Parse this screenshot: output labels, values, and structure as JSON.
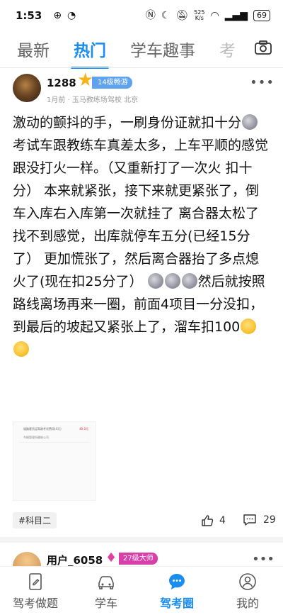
{
  "status_bar": {
    "time": "1:53",
    "network_speed_value": "525",
    "network_speed_unit": "K/s",
    "battery": "69"
  },
  "tabs": [
    {
      "label": "最新"
    },
    {
      "label": "热门"
    },
    {
      "label": "学车趣事"
    },
    {
      "label": "考"
    }
  ],
  "post": {
    "username": "1288",
    "level_badge": "14级畅游",
    "meta": "1月前 · 玉马教练场驾校  北京",
    "text_parts": [
      "激动的颤抖的手，一刷身份证就扣十分",
      " 考试车跟教练车真差太多，上车平顺的感觉跟没打火一样。（又重新打了一次火 扣十分） 本来就紧张，接下来就更紧张了，倒车入库右入库第一次就挂了 离合器太松了 找不到感觉，出库就停车五分(已经15分了） 更加慌张了，然后离合器抬了多点熄火了(现在扣25分了）",
      "然后就按照路线离场再来一圈，前面4项目一分没扣，到最后的坡起又紧张上了，溜车扣100"
    ],
    "attachment": {
      "line1": "道路客货运驾驶考试费用(4元)",
      "amount": "40.0元",
      "line2": "车辆管理所缴纳公司"
    },
    "tag": "#科目二",
    "like_count": "4",
    "comment_count": "29"
  },
  "next_post": {
    "username": "用户_6058",
    "level_badge": "27级大师"
  },
  "bottom_nav": [
    {
      "label": "驾考做题"
    },
    {
      "label": "学车"
    },
    {
      "label": "驾考圈"
    },
    {
      "label": "我的"
    }
  ],
  "colors": {
    "accent": "#1a8df0",
    "level_badge_blue": "#5fa3f0",
    "level_badge_pink": "#d93fa8"
  }
}
